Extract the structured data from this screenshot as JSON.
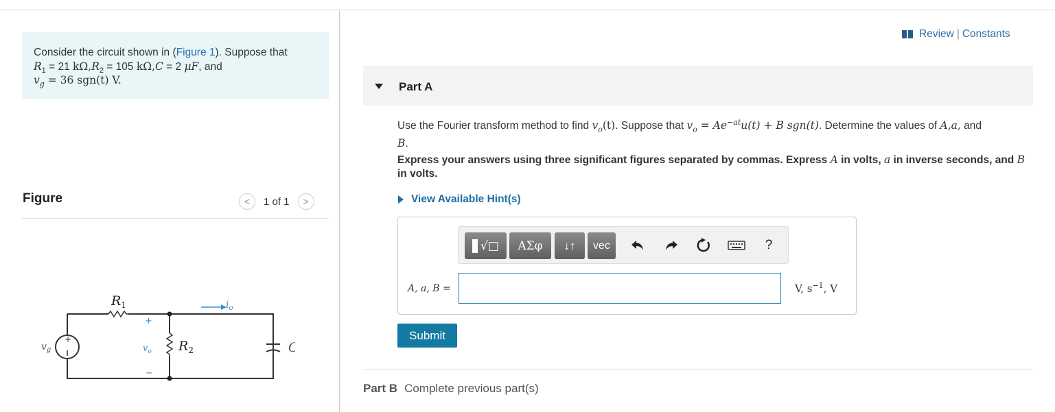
{
  "problem": {
    "line1_pre": "Consider the circuit shown in (",
    "line1_link": "Figure 1",
    "line1_post": "). Suppose that",
    "r1_symbol": "R",
    "r1_sub": "1",
    "r1_val": " = 21 ",
    "r1_unit": "kΩ,",
    "r2_symbol": "R",
    "r2_sub": "2",
    "r2_val": " = 105 ",
    "r2_unit": "kΩ,",
    "c_symbol": "C",
    "c_val": " = 2 ",
    "c_unit": "μF",
    "and": ", and",
    "vg": "v",
    "vg_sub": "g",
    "vg_expr": " = 36 sgn(t) V."
  },
  "figure": {
    "title": "Figure",
    "pager_text": "1 of 1",
    "prev": "<",
    "next": ">"
  },
  "circuit": {
    "r1": "R",
    "r1_sub": "1",
    "r2": "R",
    "r2_sub": "2",
    "c": "C",
    "vg": "v",
    "vg_sub": "g",
    "vo": "v",
    "vo_sub": "o",
    "io": "i",
    "io_sub": "o",
    "plus": "+",
    "minus": "−"
  },
  "header_links": {
    "review": "Review",
    "sep": "|",
    "constants": "Constants"
  },
  "part_a": {
    "label": "Part A",
    "q_pre": "Use the Fourier transform method to find ",
    "q_vo": "v",
    "q_vo_sub": "o",
    "q_vo_arg": "(t)",
    "q_mid": ". Suppose that ",
    "q_expr_pre": "v",
    "q_expr_sub": "o",
    "q_expr_body": " = Ae",
    "q_expr_exp": "−at",
    "q_expr_tail": "u(t) + B sgn(t)",
    "q_post": ". Determine the values of ",
    "q_vars": "A,a,",
    "q_and": " and",
    "q_B": "B",
    "q_end": ".",
    "instr_pre": "Express your answers using three significant figures separated by commas. Express ",
    "instr_A": "A",
    "instr_mid1": " in volts, ",
    "instr_a": "a",
    "instr_mid2": " in inverse seconds, and ",
    "instr_B": "B",
    "instr_end": " in volts.",
    "hints": "View Available Hint(s)",
    "answer_label": "A, a, B =",
    "answer_value": "",
    "units": "V, s",
    "units_exp": "−1",
    "units_tail": ", V",
    "submit": "Submit"
  },
  "toolbar": {
    "templates": "√□",
    "greek": "ΑΣφ",
    "arrows": "↓↑",
    "vec": "vec",
    "help": "?"
  },
  "part_b": {
    "label": "Part B",
    "status": "Complete previous part(s)"
  }
}
